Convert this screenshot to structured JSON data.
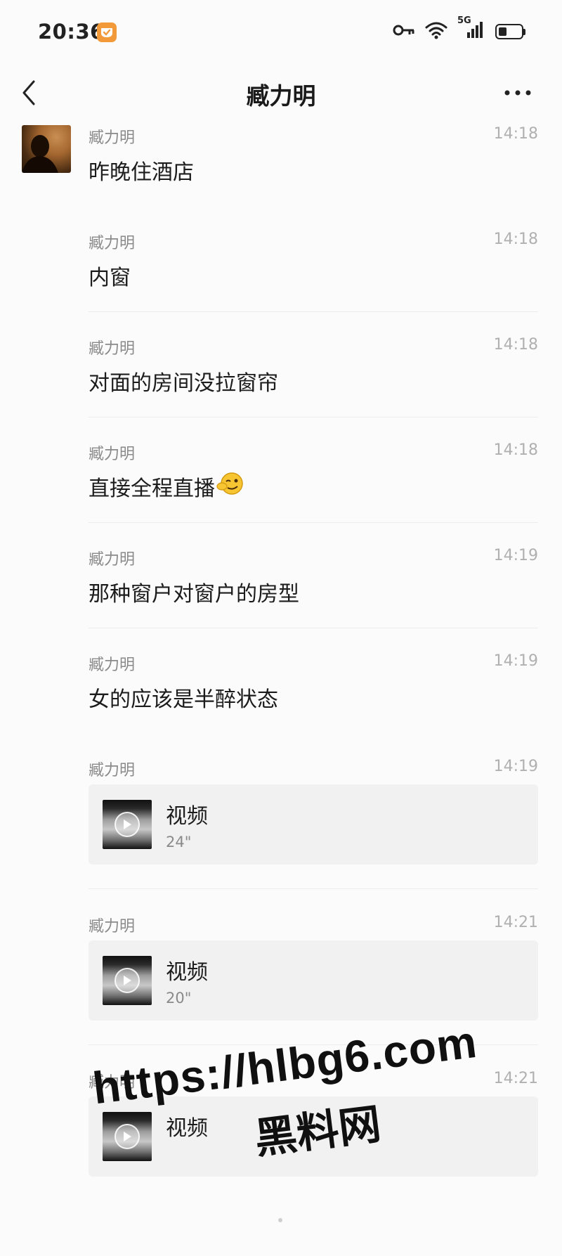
{
  "status_bar": {
    "time": "20:36",
    "network": "5G",
    "app_icon": "app-badge-icon",
    "icons": [
      "key-icon",
      "wifi-icon",
      "cellular-signal-icon",
      "battery-icon"
    ],
    "battery_level": 0.3
  },
  "nav": {
    "title": "臧力明",
    "back_icon": "chevron-left-icon",
    "more_icon": "more-dots-icon"
  },
  "colors": {
    "background": "#fbfbfb",
    "badge": "#f29a3a",
    "meta_text": "#8a8a8a",
    "time_text": "#b0b0b0",
    "video_card": "#f1f1f1"
  },
  "messages": [
    {
      "sender": "臧力明",
      "time": "14:18",
      "text": "昨晚住酒店"
    },
    {
      "sender": "臧力明",
      "time": "14:18",
      "text": "内窗"
    },
    {
      "sender": "臧力明",
      "time": "14:18",
      "text": "对面的房间没拉窗帘"
    },
    {
      "sender": "臧力明",
      "time": "14:18",
      "text": "直接全程直播",
      "emoji": "wink-face-icon"
    },
    {
      "sender": "臧力明",
      "time": "14:19",
      "text": "那种窗户对窗户的房型"
    },
    {
      "sender": "臧力明",
      "time": "14:19",
      "text": "女的应该是半醉状态"
    },
    {
      "sender": "臧力明",
      "time": "14:19",
      "video": {
        "label": "视频",
        "duration": "24\""
      }
    },
    {
      "sender": "臧力明",
      "time": "14:21",
      "video": {
        "label": "视频",
        "duration": "20\""
      }
    },
    {
      "sender": "臧力明",
      "time": "14:21",
      "video": {
        "label": "视频",
        "duration": ""
      }
    }
  ],
  "watermark": {
    "url": "https://hlbg6.com",
    "name": "黑料网"
  }
}
